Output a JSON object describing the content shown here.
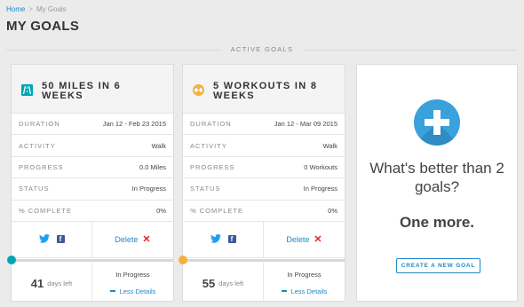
{
  "breadcrumb": {
    "home": "Home",
    "separator": ">",
    "current": "My Goals"
  },
  "page": {
    "title": "MY GOALS"
  },
  "section": {
    "label": "ACTIVE GOALS"
  },
  "colors": {
    "accent": "#1e88c8",
    "teal": "#00a6b5",
    "yellow": "#f6b13b",
    "delete": "#d9262e",
    "plus": "#3aa1dd"
  },
  "goals": [
    {
      "icon": "road-icon",
      "title": "50 MILES IN 6 WEEKS",
      "rows": [
        {
          "label": "DURATION",
          "value": "Jan 12 - Feb 23 2015"
        },
        {
          "label": "ACTIVITY",
          "value": "Walk"
        },
        {
          "label": "PROGRESS",
          "value": "0.0 Miles"
        },
        {
          "label": "STATUS",
          "value": "In Progress"
        },
        {
          "label": "% COMPLETE",
          "value": "0%"
        }
      ],
      "delete_label": "Delete",
      "delete_symbol": "✕",
      "progress_fraction": 0,
      "days_number": "41",
      "days_label": "days left",
      "status": "In Progress",
      "less_details": "Less Details"
    },
    {
      "icon": "workout-icon",
      "title": "5 WORKOUTS IN 8 WEEKS",
      "rows": [
        {
          "label": "DURATION",
          "value": "Jan 12 - Mar 09 2015"
        },
        {
          "label": "ACTIVITY",
          "value": "Walk"
        },
        {
          "label": "PROGRESS",
          "value": "0 Workouts"
        },
        {
          "label": "STATUS",
          "value": "In Progress"
        },
        {
          "label": "% COMPLETE",
          "value": "0%"
        }
      ],
      "delete_label": "Delete",
      "delete_symbol": "✕",
      "progress_fraction": 0,
      "days_number": "55",
      "days_label": "days left",
      "status": "In Progress",
      "less_details": "Less Details"
    }
  ],
  "promo": {
    "icon": "plus-circle-icon",
    "question": "What's better than 2 goals?",
    "answer": "One more.",
    "button": "CREATE A NEW GOAL"
  }
}
